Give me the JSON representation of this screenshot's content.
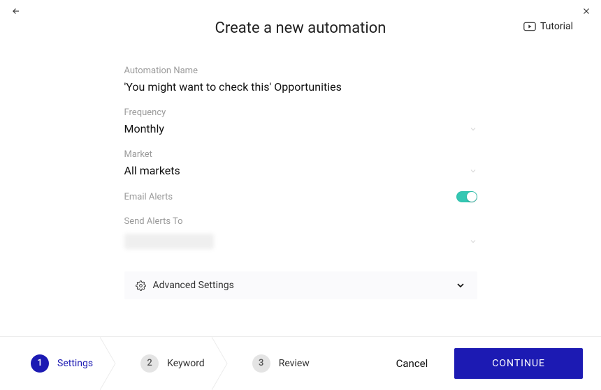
{
  "header": {
    "title": "Create a new automation",
    "tutorial_label": "Tutorial"
  },
  "form": {
    "name_label": "Automation Name",
    "name_value": "'You might want to check this' Opportunities",
    "frequency_label": "Frequency",
    "frequency_value": "Monthly",
    "market_label": "Market",
    "market_value": "All markets",
    "email_alerts_label": "Email Alerts",
    "email_alerts_on": true,
    "send_to_label": "Send Alerts To",
    "advanced_label": "Advanced Settings"
  },
  "steps": [
    {
      "num": "1",
      "label": "Settings",
      "active": true
    },
    {
      "num": "2",
      "label": "Keyword",
      "active": false
    },
    {
      "num": "3",
      "label": "Review",
      "active": false
    }
  ],
  "actions": {
    "cancel": "Cancel",
    "continue": "CONTINUE"
  }
}
